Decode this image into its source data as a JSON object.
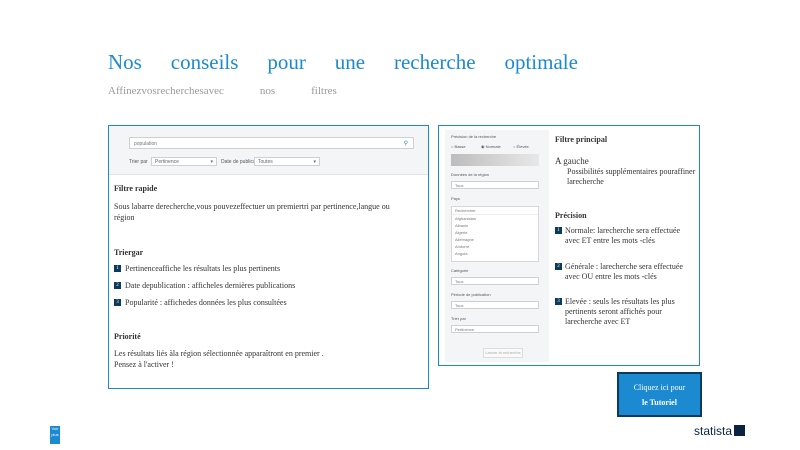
{
  "header": {
    "title_words": [
      "Nos",
      "conseils",
      "pour",
      "une",
      "recherche",
      "optimale"
    ],
    "subtitle_parts": [
      "Affinezvosrecherchesavec",
      "nos",
      "filtres"
    ]
  },
  "left_panel": {
    "mock": {
      "search_value": "population",
      "search_icon": "search-icon",
      "filter1_label": "Trier par",
      "filter1_value": "Pertinence",
      "filter2_label": "Date de publication",
      "filter2_value": "Toutes"
    },
    "quick_filter": {
      "heading": "Filtre rapide",
      "text": "Sous labarre derecherche,vous pouvezeffectuer un premiertri par pertinence,langue ou région"
    },
    "sort": {
      "heading": "Triergar",
      "items": [
        {
          "marker": "1",
          "text": "Pertinenceaffiche les résultats les plus pertinents"
        },
        {
          "marker": "2",
          "text": "Date depublication : afficheles dernières publications"
        },
        {
          "marker": "3",
          "text": "Popularité : affichedes données les plus consultées"
        }
      ]
    },
    "priority": {
      "heading": "Priorité",
      "text_line1": "Les résultats liés àla région sélectionnée apparaîtront en premier .",
      "text_line2": "Pensez à l'activer !"
    }
  },
  "right_panel": {
    "mock": {
      "accuracy_label": "Précision de la recherche",
      "radio_options": [
        "Basse",
        "Normale",
        "Élevée"
      ],
      "section_label": "Données de la région",
      "select_value": "Tous",
      "country_label": "Pays",
      "list_search_placeholder": "Rechercher",
      "list_items": [
        "Afghanistan",
        "Albanie",
        "Algérie",
        "Allemagne",
        "Andorre",
        "Angola",
        "Arabie"
      ],
      "category_label": "Catégorie",
      "category_value": "Tous",
      "period_label": "Période de publication",
      "period_value": "Tous",
      "sort_label": "Trier par",
      "sort_value": "Pertinence",
      "submit_label": "Lancer la recherche"
    },
    "main_filter": {
      "heading": "Filtre principal",
      "subheading": "A gauche",
      "desc": "Possibilités supplémentaires pouraffiner larecherche"
    },
    "precision": {
      "heading": "Précision",
      "items": [
        {
          "marker": "1",
          "text": "Normale: larecherche sera effectuée avec ET entre les mots -clés"
        },
        {
          "marker": "2",
          "text": "Générale : larecherche sera effectuée avec OU entre les mots -clés"
        },
        {
          "marker": "3",
          "text": "Elevée : seuls les résultats les plus pertinents seront affichés pour larecherche avec ET"
        }
      ]
    }
  },
  "tutorial_button": {
    "line1": "Cliquez ici pour",
    "line2": "le Tutoriel"
  },
  "brand": {
    "logo_text": "statista",
    "corner_badge": "Voir plus",
    "accent_color": "#1b8ad0",
    "dark_color": "#0b3a5c"
  }
}
